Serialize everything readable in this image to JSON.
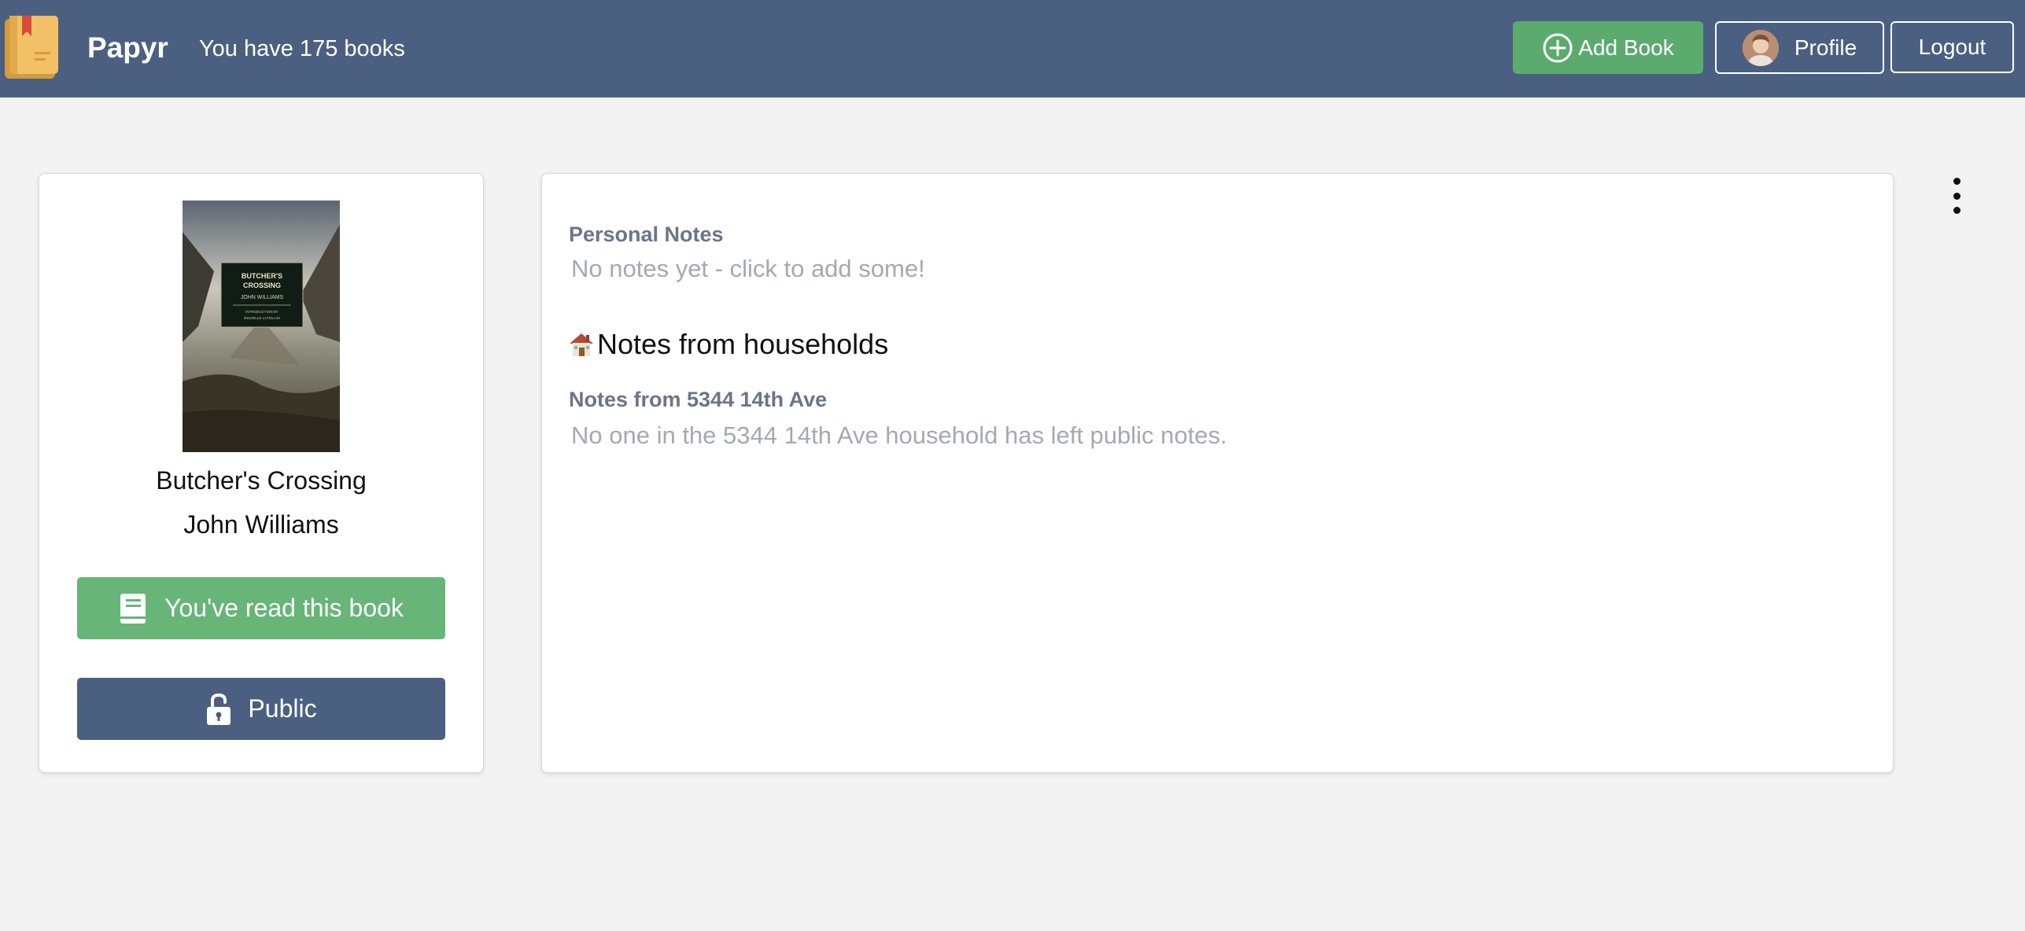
{
  "header": {
    "app_name": "Papyr",
    "book_count_text": "You have 175 books",
    "add_book_label": "Add Book",
    "profile_label": "Profile",
    "logout_label": "Logout",
    "background_color": "#4b6081"
  },
  "book": {
    "cover": {
      "title_line_1": "BUTCHER'S",
      "title_line_2": "CROSSING",
      "author": "JOHN WILLIAMS",
      "intro_line_1": "INTRODUCTION BY",
      "intro_line_2": "MICHELLE LATIOLAIS"
    },
    "title": "Butcher's Crossing",
    "author": "John Williams",
    "read_button_label": "You've read this book",
    "visibility_button_label": "Public",
    "read_icon": "book-icon",
    "visibility_icon": "unlocked-padlock-icon",
    "read_button_color": "#67b577",
    "visibility_button_color": "#4b6081"
  },
  "notes": {
    "personal_label": "Personal Notes",
    "personal_placeholder": "No notes yet - click to add some!",
    "households_heading": "Notes from households",
    "households_icon": "house-icon",
    "household": {
      "label": "Notes from 5344 14th Ave",
      "empty_text": "No one in the 5344 14th Ave household has left public notes."
    }
  },
  "menu": {
    "icon": "more-vertical-icon"
  }
}
